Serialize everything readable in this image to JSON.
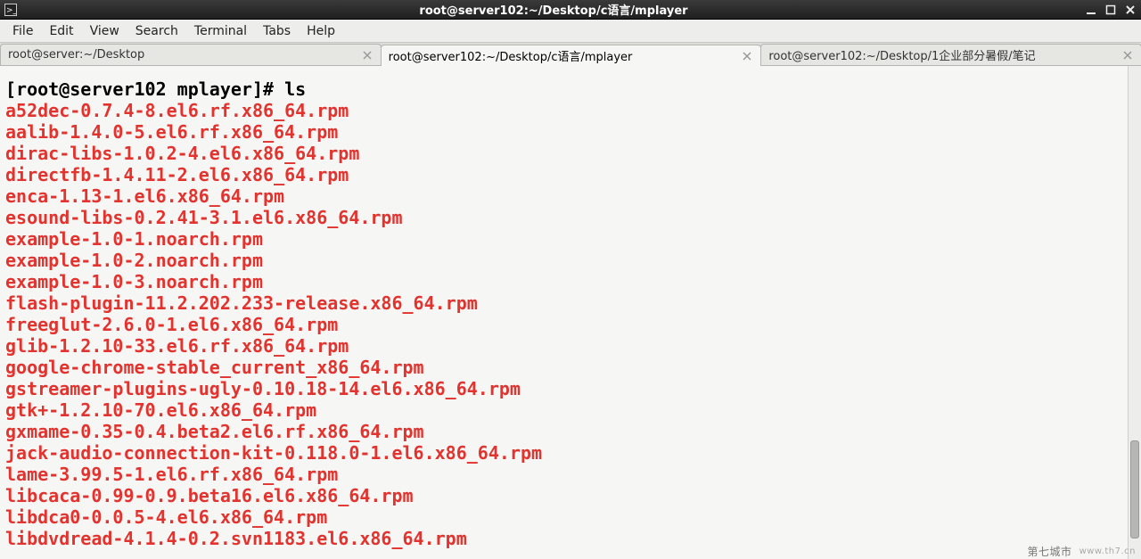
{
  "window": {
    "title": "root@server102:~/Desktop/c语言/mplayer"
  },
  "menu": {
    "items": [
      "File",
      "Edit",
      "View",
      "Search",
      "Terminal",
      "Tabs",
      "Help"
    ]
  },
  "tabs": [
    {
      "label": "root@server:~/Desktop",
      "active": false
    },
    {
      "label": "root@server102:~/Desktop/c语言/mplayer",
      "active": true
    },
    {
      "label": "root@server102:~/Desktop/1企业部分暑假/笔记",
      "active": false
    }
  ],
  "terminal": {
    "prompt": "[root@server102 mplayer]# ",
    "command": "ls",
    "files": [
      "a52dec-0.7.4-8.el6.rf.x86_64.rpm",
      "aalib-1.4.0-5.el6.rf.x86_64.rpm",
      "dirac-libs-1.0.2-4.el6.x86_64.rpm",
      "directfb-1.4.11-2.el6.x86_64.rpm",
      "enca-1.13-1.el6.x86_64.rpm",
      "esound-libs-0.2.41-3.1.el6.x86_64.rpm",
      "example-1.0-1.noarch.rpm",
      "example-1.0-2.noarch.rpm",
      "example-1.0-3.noarch.rpm",
      "flash-plugin-11.2.202.233-release.x86_64.rpm",
      "freeglut-2.6.0-1.el6.x86_64.rpm",
      "glib-1.2.10-33.el6.rf.x86_64.rpm",
      "google-chrome-stable_current_x86_64.rpm",
      "gstreamer-plugins-ugly-0.10.18-14.el6.x86_64.rpm",
      "gtk+-1.2.10-70.el6.x86_64.rpm",
      "gxmame-0.35-0.4.beta2.el6.rf.x86_64.rpm",
      "jack-audio-connection-kit-0.118.0-1.el6.x86_64.rpm",
      "lame-3.99.5-1.el6.rf.x86_64.rpm",
      "libcaca-0.99-0.9.beta16.el6.x86_64.rpm",
      "libdca0-0.0.5-4.el6.x86_64.rpm",
      "libdvdread-4.1.4-0.2.svn1183.el6.x86_64.rpm"
    ]
  },
  "watermark": {
    "brand": "第七城市",
    "url": "www.th7.cn"
  }
}
